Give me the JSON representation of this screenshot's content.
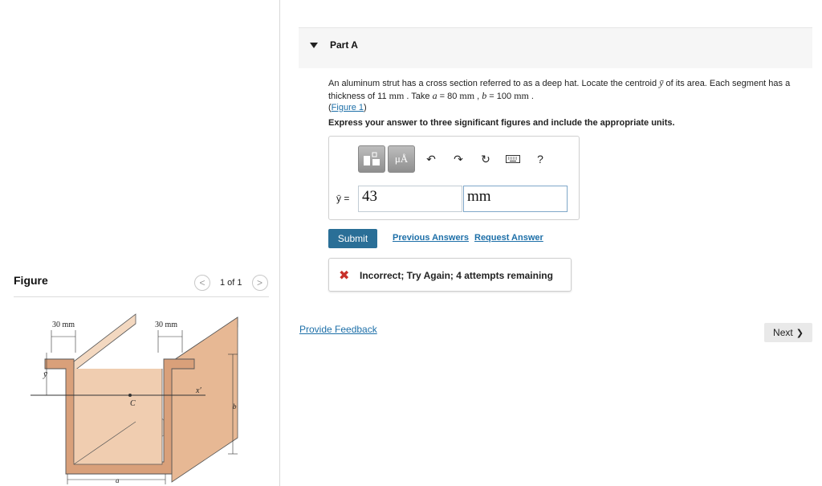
{
  "figure_panel": {
    "title": "Figure",
    "counter": "1 of 1",
    "prev_glyph": "<",
    "next_glyph": ">",
    "labels": {
      "dim_left": "30 mm",
      "dim_right": "30 mm",
      "ybar": "ȳ",
      "centroid": "C",
      "x_axis": "x′",
      "b": "b",
      "a": "a"
    }
  },
  "part": {
    "title": "Part A",
    "problem_1": "An aluminum strut has a cross section referred to as a deep hat. Locate the centroid ",
    "problem_symbol": "ȳ",
    "problem_2": " of its area. Each segment has a thickness of 11 ",
    "unit_mm_1": "mm",
    "problem_3": " . Take ",
    "var_a": "a",
    "problem_4": " = 80 ",
    "unit_mm_2": "mm",
    "problem_5": " , ",
    "var_b": "b",
    "problem_6": " = 100 ",
    "unit_mm_3": "mm",
    "problem_7": " .",
    "figure_link_open": "(",
    "figure_link": "Figure 1",
    "figure_link_close": ")",
    "instruction": "Express your answer to three significant figures and include the appropriate units."
  },
  "answer": {
    "variable_label": "ȳ =",
    "value": "43",
    "unit": "mm",
    "toolbar": {
      "templates_icon": "template-icon",
      "units_label": "μÅ",
      "undo_icon": "↶",
      "redo_icon": "↷",
      "reset_icon": "↻",
      "keyboard_icon": "keyboard-icon",
      "help_label": "?"
    }
  },
  "actions": {
    "submit": "Submit",
    "previous_answers": "Previous Answers",
    "request_answer": "Request Answer"
  },
  "feedback": {
    "icon": "✖",
    "message": "Incorrect; Try Again; 4 attempts remaining"
  },
  "footer": {
    "provide_feedback": "Provide Feedback",
    "next": "Next",
    "next_glyph": "❯"
  },
  "colors": {
    "link": "#1d6fa8",
    "submit_bg": "#2a6f97",
    "error": "#c8302a",
    "strut_face": "#d9a07a",
    "strut_top": "#f3d8c0"
  }
}
